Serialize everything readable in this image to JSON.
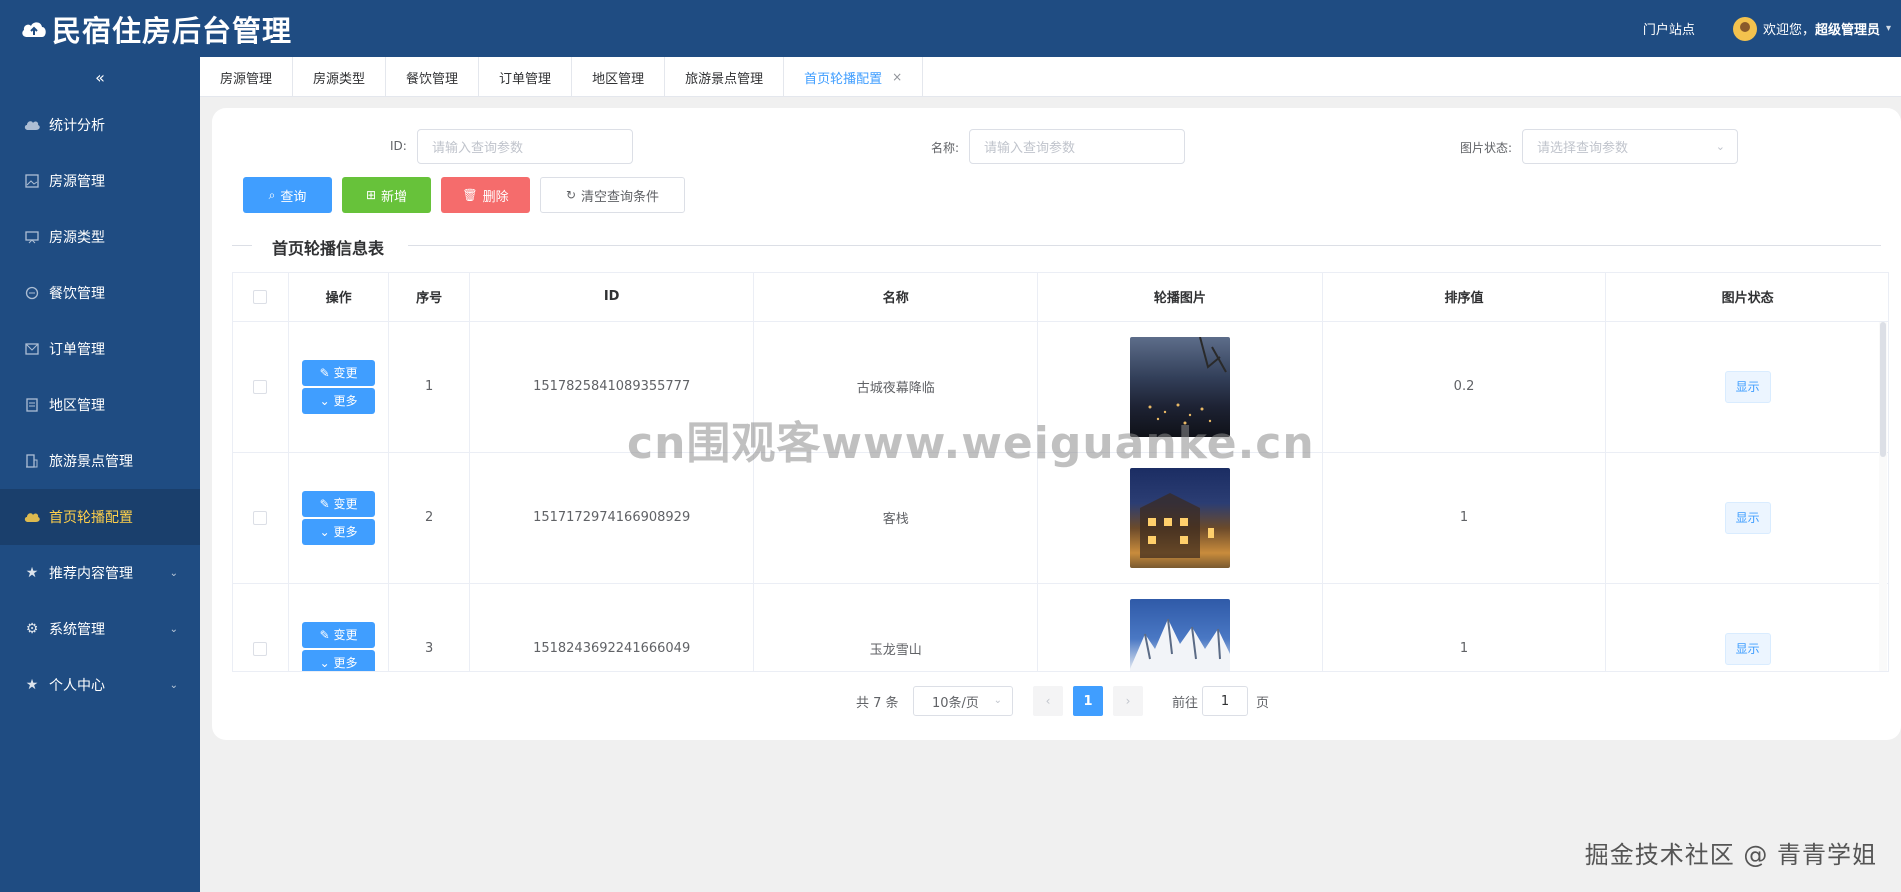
{
  "header": {
    "title": "民宿住房后台管理",
    "portal_link": "门户站点",
    "welcome_prefix": "欢迎您，",
    "username": "超级管理员",
    "colors": {
      "header_bg": "#1f4c82",
      "accent": "#409eff"
    }
  },
  "sidebar": {
    "collapse_icon": "«",
    "items": [
      {
        "label": "统计分析",
        "icon": "cloud-icon",
        "active": false,
        "submenu": false
      },
      {
        "label": "房源管理",
        "icon": "image-icon",
        "active": false,
        "submenu": false
      },
      {
        "label": "房源类型",
        "icon": "display-icon",
        "active": false,
        "submenu": false
      },
      {
        "label": "餐饮管理",
        "icon": "chat-icon",
        "active": false,
        "submenu": false
      },
      {
        "label": "订单管理",
        "icon": "mail-icon",
        "active": false,
        "submenu": false
      },
      {
        "label": "地区管理",
        "icon": "document-icon",
        "active": false,
        "submenu": false
      },
      {
        "label": "旅游景点管理",
        "icon": "building-icon",
        "active": false,
        "submenu": false
      },
      {
        "label": "首页轮播配置",
        "icon": "cloud-icon",
        "active": true,
        "submenu": false
      },
      {
        "label": "推荐内容管理",
        "icon": "star-icon",
        "active": false,
        "submenu": true
      },
      {
        "label": "系统管理",
        "icon": "gear-icon",
        "active": false,
        "submenu": true
      },
      {
        "label": "个人中心",
        "icon": "star-icon",
        "active": false,
        "submenu": true
      }
    ]
  },
  "tabs": [
    {
      "label": "房源管理",
      "active": false
    },
    {
      "label": "房源类型",
      "active": false
    },
    {
      "label": "餐饮管理",
      "active": false
    },
    {
      "label": "订单管理",
      "active": false
    },
    {
      "label": "地区管理",
      "active": false
    },
    {
      "label": "旅游景点管理",
      "active": false
    },
    {
      "label": "首页轮播配置",
      "active": true,
      "closable": true
    }
  ],
  "filters": {
    "id_label": "ID:",
    "id_placeholder": "请输入查询参数",
    "name_label": "名称:",
    "name_placeholder": "请输入查询参数",
    "status_label": "图片状态:",
    "status_placeholder": "请选择查询参数"
  },
  "actions": {
    "search": "查询",
    "add": "新增",
    "delete": "删除",
    "clear": "清空查询条件"
  },
  "table": {
    "title": "首页轮播信息表",
    "columns": [
      "",
      "操作",
      "序号",
      "ID",
      "名称",
      "轮播图片",
      "排序值",
      "图片状态"
    ],
    "edit_label": "变更",
    "more_label": "更多",
    "rows": [
      {
        "index": "1",
        "id": "1517825841089355777",
        "name": "古城夜幕降临",
        "image": "night-town-photo",
        "sort": "0.2",
        "status": "显示"
      },
      {
        "index": "2",
        "id": "1517172974166908929",
        "name": "客栈",
        "image": "inn-photo",
        "sort": "1",
        "status": "显示"
      },
      {
        "index": "3",
        "id": "1518243692241666049",
        "name": "玉龙雪山",
        "image": "snow-mountain-photo",
        "sort": "1",
        "status": "显示"
      }
    ]
  },
  "pagination": {
    "total": "共 7 条",
    "page_size": "10条/页",
    "current_page": "1",
    "goto_label": "前往",
    "goto_value": "1",
    "page_suffix": "页"
  },
  "watermark": "cn围观客www.weiguanke.cn",
  "credit": "掘金技术社区 @ 青青学姐"
}
